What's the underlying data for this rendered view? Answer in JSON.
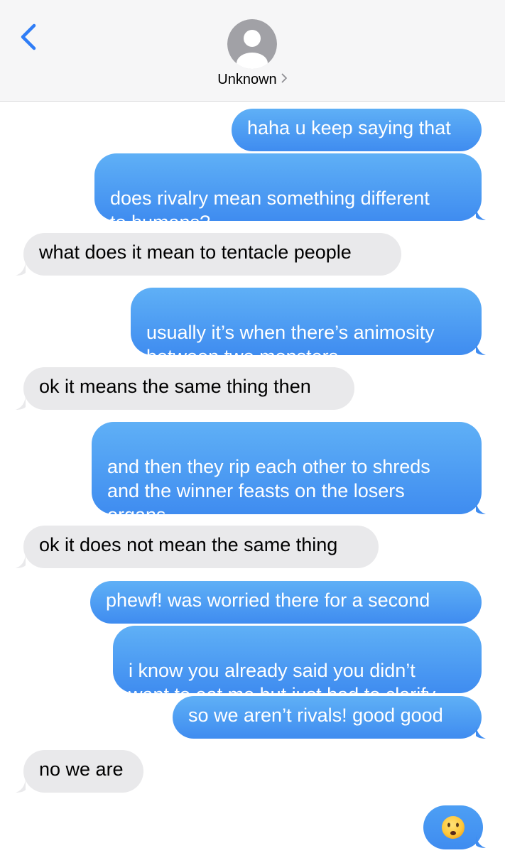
{
  "header": {
    "contact_name": "Unknown"
  },
  "messages": [
    {
      "from": "me",
      "text": "haha u keep saying that"
    },
    {
      "from": "me",
      "text": "does rivalry mean something different\nto humans?"
    },
    {
      "from": "them",
      "text": "what does it mean to tentacle people"
    },
    {
      "from": "me",
      "text": "usually it’s when there’s animosity\nbetween two monsters"
    },
    {
      "from": "them",
      "text": "ok it means the same thing then"
    },
    {
      "from": "me",
      "text": "and then they rip each other to shreds\nand the winner feasts on the losers\norgans"
    },
    {
      "from": "them",
      "text": "ok it does not mean the same thing"
    },
    {
      "from": "me",
      "text": "phewf! was worried there for a second"
    },
    {
      "from": "me",
      "text": "i know you already said you didn’t\nwant to eat me but just had to clarify"
    },
    {
      "from": "me",
      "text": "so we aren’t rivals! good good"
    },
    {
      "from": "them",
      "text": "no we are"
    },
    {
      "from": "me",
      "type": "emoji",
      "emoji": "frowning-face-with-open-mouth-icon"
    }
  ],
  "colors": {
    "outgoing_top": "#5fb0f6",
    "outgoing_bottom": "#3f8cf0",
    "incoming": "#e9e9eb",
    "header_bg": "#f6f6f7",
    "accent": "#2f7df6"
  }
}
